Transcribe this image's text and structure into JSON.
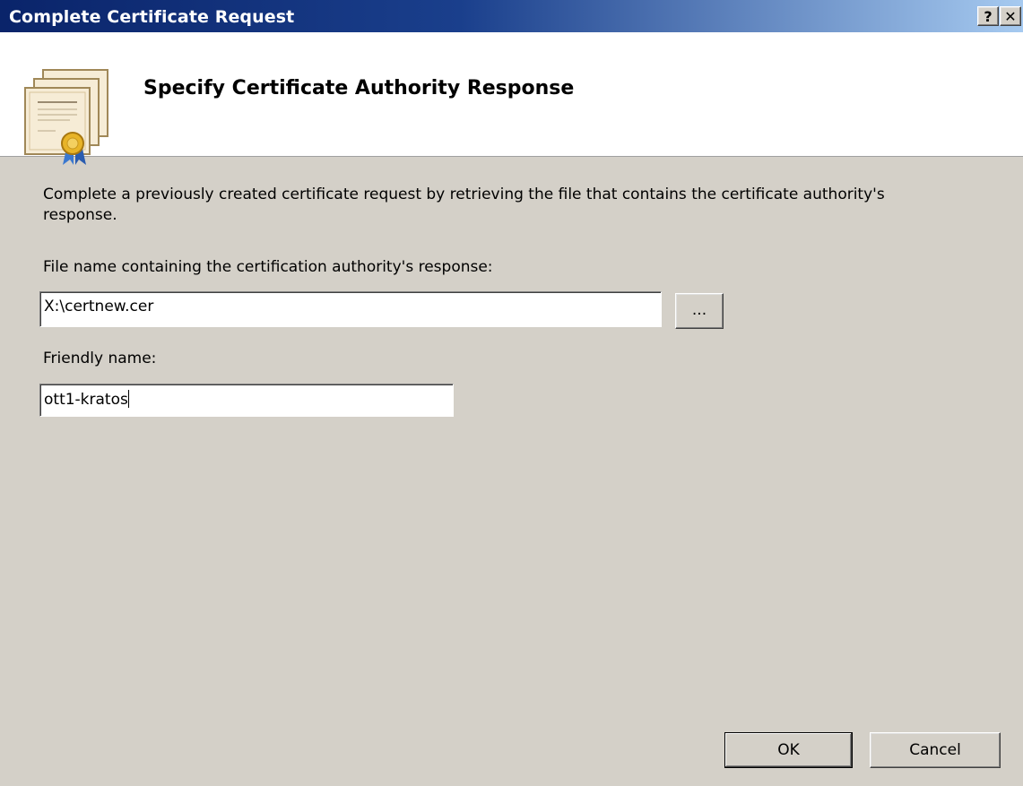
{
  "window": {
    "title": "Complete Certificate Request",
    "help_label": "?",
    "close_label": "✕"
  },
  "header": {
    "title": "Specify Certificate Authority Response",
    "icon": "certificate-icon"
  },
  "body": {
    "description": "Complete a previously created certificate request by retrieving the file that contains the certificate authority's response.",
    "file_label": "File name containing the certification authority's response:",
    "file_value": "X:\\certnew.cer",
    "browse_label": "...",
    "friendly_label": "Friendly name:",
    "friendly_value": "ott1-kratos"
  },
  "buttons": {
    "ok": "OK",
    "cancel": "Cancel"
  }
}
